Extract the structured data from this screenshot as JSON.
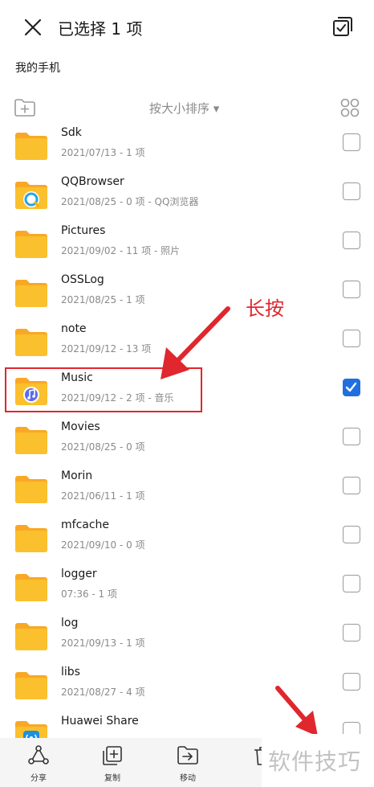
{
  "header": {
    "title": "已选择 1 项",
    "close_icon": "close-icon",
    "select_all_icon": "select-all-icon"
  },
  "breadcrumb": "我的手机",
  "toolbar": {
    "sort_label": "按大小排序 ▾",
    "new_folder_icon": "new-folder-icon",
    "grid_icon": "grid-view-icon"
  },
  "files": [
    {
      "name": "Sdk",
      "meta": "2021/07/13 - 1 项",
      "badge": "",
      "checked": false
    },
    {
      "name": "QQBrowser",
      "meta": "2021/08/25 - 0 项 - QQ浏览器",
      "badge": "qqbrowser",
      "checked": false
    },
    {
      "name": "Pictures",
      "meta": "2021/09/02 - 11 项 - 照片",
      "badge": "",
      "checked": false
    },
    {
      "name": "OSSLog",
      "meta": "2021/08/25 - 1 项",
      "badge": "",
      "checked": false
    },
    {
      "name": "note",
      "meta": "2021/09/12 - 13 项",
      "badge": "",
      "checked": false
    },
    {
      "name": "Music",
      "meta": "2021/09/12 - 2 项 - 音乐",
      "badge": "music",
      "checked": true
    },
    {
      "name": "Movies",
      "meta": "2021/08/25 - 0 项",
      "badge": "",
      "checked": false
    },
    {
      "name": "Morin",
      "meta": "2021/06/11 - 1 项",
      "badge": "",
      "checked": false
    },
    {
      "name": "mfcache",
      "meta": "2021/09/10 - 0 项",
      "badge": "",
      "checked": false
    },
    {
      "name": "logger",
      "meta": "07:36 - 1 项",
      "badge": "",
      "checked": false
    },
    {
      "name": "log",
      "meta": "2021/09/13 - 1 项",
      "badge": "",
      "checked": false
    },
    {
      "name": "libs",
      "meta": "2021/08/27 - 4 项",
      "badge": "",
      "checked": false
    },
    {
      "name": "Huawei Share",
      "meta": "",
      "badge": "share",
      "checked": false
    }
  ],
  "annotation": {
    "label": "长按"
  },
  "bottom_bar": {
    "share": "分享",
    "copy": "复制",
    "move": "移动"
  },
  "watermark": "软件技巧",
  "colors": {
    "folder": "#FBC02D",
    "folder_tab": "#F9A825",
    "accent": "#1F6FE0",
    "annotation": "#E0272D"
  }
}
